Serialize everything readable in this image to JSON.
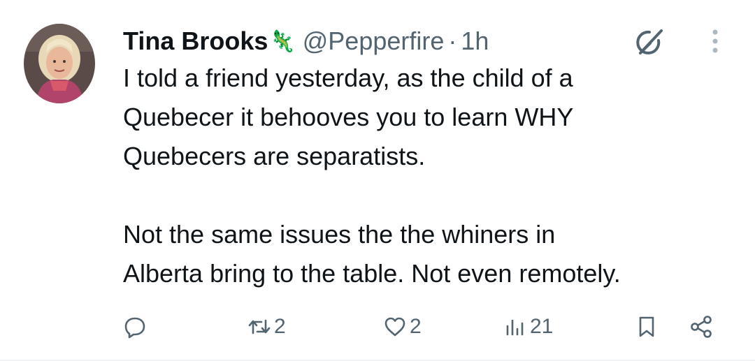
{
  "author": {
    "name": "Tina Brooks",
    "badge_emoji": "🦎",
    "handle": "@Pepperfire",
    "separator": "·",
    "time": "1h",
    "avatar_icon": "profile-photo"
  },
  "tweet": {
    "paragraphs": [
      "I told a friend yesterday, as the child of a\nQuebecer it behooves you to learn WHY\nQuebecers are separatists.",
      "Not the same issues the the whiners in\nAlberta bring to the table. Not even remotely."
    ]
  },
  "header_icons": {
    "grok": "grok-icon",
    "more": "more-vertical-icon"
  },
  "actions": {
    "reply": {
      "icon": "reply-icon",
      "count": ""
    },
    "retweet": {
      "icon": "retweet-icon",
      "count": "2"
    },
    "like": {
      "icon": "heart-icon",
      "count": "2"
    },
    "views": {
      "icon": "views-icon",
      "count": "21"
    },
    "bookmark": {
      "icon": "bookmark-icon"
    },
    "share": {
      "icon": "share-icon"
    }
  },
  "colors": {
    "text": "#0f1419",
    "secondary": "#536471",
    "divider": "#eff3f4",
    "background": "#ffffff"
  }
}
